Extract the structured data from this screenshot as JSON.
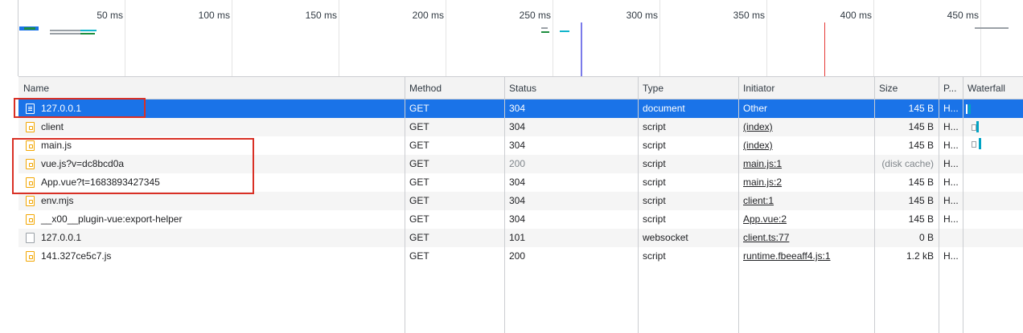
{
  "overview": {
    "ticks": [
      "50 ms",
      "100 ms",
      "150 ms",
      "200 ms",
      "250 ms",
      "300 ms",
      "350 ms",
      "400 ms",
      "450 ms"
    ],
    "colors": {
      "dom_content_loaded": "#7b7bea",
      "load": "#e53935",
      "waiting": "#00a3c4",
      "queued": "#9aa0a6"
    }
  },
  "columns": {
    "name": "Name",
    "method": "Method",
    "status": "Status",
    "type": "Type",
    "initiator": "Initiator",
    "size": "Size",
    "priority": "P...",
    "waterfall": "Waterfall"
  },
  "rows": [
    {
      "name": "127.0.0.1",
      "icon": "document-icon",
      "method": "GET",
      "status": "304",
      "type": "document",
      "initiator": "Other",
      "size": "145 B",
      "priority": "H..."
    },
    {
      "name": "client",
      "icon": "script-icon",
      "method": "GET",
      "status": "304",
      "type": "script",
      "initiator": "(index)",
      "size": "145 B",
      "priority": "H..."
    },
    {
      "name": "main.js",
      "icon": "script-icon",
      "method": "GET",
      "status": "304",
      "type": "script",
      "initiator": "(index)",
      "size": "145 B",
      "priority": "H..."
    },
    {
      "name": "vue.js?v=dc8bcd0a",
      "icon": "script-icon",
      "method": "GET",
      "status": "200",
      "type": "script",
      "initiator": "main.js:1",
      "size": "(disk cache)",
      "priority": "H..."
    },
    {
      "name": "App.vue?t=1683893427345",
      "icon": "script-icon",
      "method": "GET",
      "status": "304",
      "type": "script",
      "initiator": "main.js:2",
      "size": "145 B",
      "priority": "H..."
    },
    {
      "name": "env.mjs",
      "icon": "script-icon",
      "method": "GET",
      "status": "304",
      "type": "script",
      "initiator": "client:1",
      "size": "145 B",
      "priority": "H..."
    },
    {
      "name": "__x00__plugin-vue:export-helper",
      "icon": "script-icon",
      "method": "GET",
      "status": "304",
      "type": "script",
      "initiator": "App.vue:2",
      "size": "145 B",
      "priority": "H..."
    },
    {
      "name": "127.0.0.1",
      "icon": "websocket-icon",
      "method": "GET",
      "status": "101",
      "type": "websocket",
      "initiator": "client.ts:77",
      "size": "0 B",
      "priority": ""
    },
    {
      "name": "141.327ce5c7.js",
      "icon": "script-icon",
      "method": "GET",
      "status": "200",
      "type": "script",
      "initiator": "runtime.fbeeaff4.js:1",
      "size": "1.2 kB",
      "priority": "H..."
    }
  ]
}
